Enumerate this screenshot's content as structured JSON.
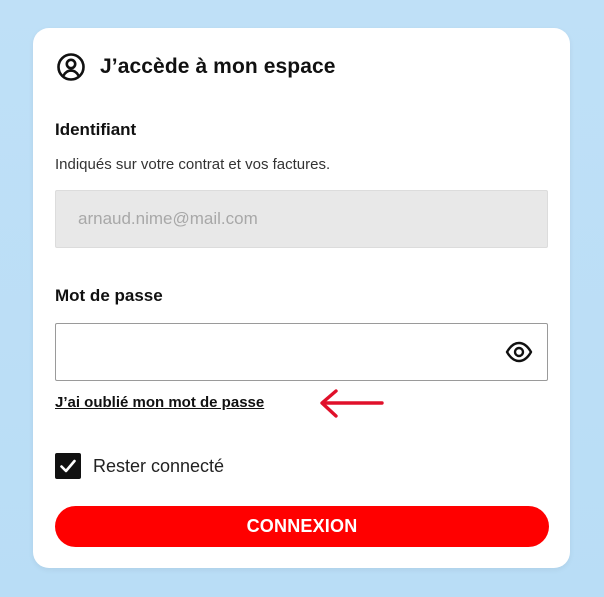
{
  "header": {
    "title": "J’accède à mon espace",
    "icon": "user-circle-icon"
  },
  "identifier": {
    "label": "Identifiant",
    "hint": "Indiqués sur votre contrat et vos factures.",
    "placeholder": "arnaud.nime@mail.com",
    "value": ""
  },
  "password": {
    "label": "Mot de passe",
    "value": "",
    "toggle_icon": "eye-icon",
    "forgot_link": "J’ai oublié mon mot de passe"
  },
  "annotation": {
    "icon": "arrow-left-icon",
    "color": "#e0102a"
  },
  "remember": {
    "label": "Rester connecté",
    "checked": true
  },
  "submit": {
    "label": "CONNEXION",
    "color": "#ff0000"
  }
}
